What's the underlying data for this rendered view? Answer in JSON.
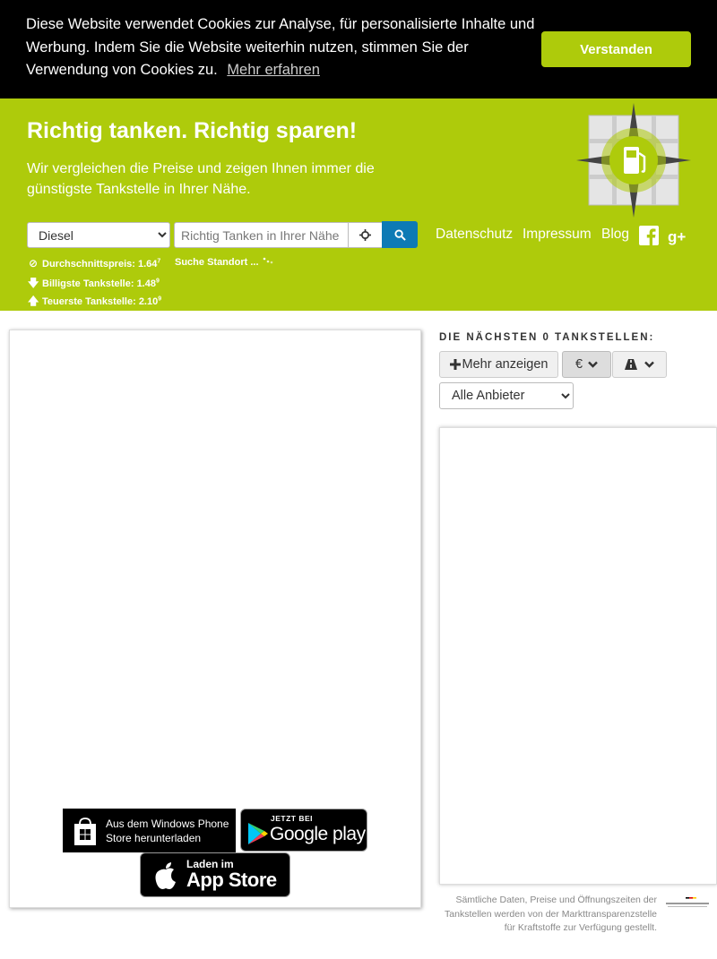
{
  "cookie": {
    "message": "Diese Website verwendet Cookies zur Analyse, für personalisierte Inhalte und Werbung. Indem Sie die Website weiterhin nutzen, stimmen Sie der Verwendung von Cookies zu.",
    "link": "Mehr erfahren",
    "button": "Verstanden"
  },
  "header": {
    "title": "Richtig tanken. Richtig sparen!",
    "subtitle": "Wir vergleichen die Preise und zeigen Ihnen immer die günstigste Tankstelle in Ihrer Nähe.",
    "fuel_selected": "Diesel",
    "search_placeholder": "Richtig Tanken in Ihrer Nähe",
    "nav": [
      "Datenschutz",
      "Impressum",
      "Blog"
    ],
    "locating": "Suche Standort ..."
  },
  "stats": {
    "avg_label": "Durchschnittspreis:",
    "avg_value": "1.64",
    "avg_sup": "7",
    "cheap_label": "Billigste Tankstelle:",
    "cheap_value": "1.48",
    "cheap_sup": "9",
    "exp_label": "Teuerste Tankstelle:",
    "exp_value": "2.10",
    "exp_sup": "9"
  },
  "badges": {
    "windows_line1": "Aus dem Windows Phone",
    "windows_line2": "Store herunterladen",
    "google_line1": "JETZT BEI",
    "google_line2": "Google play",
    "apple_line1": "Laden im",
    "apple_line2": "App Store"
  },
  "side": {
    "title": "DIE NÄCHSTEN 0 TANKSTELLEN:",
    "more_button": "Mehr anzeigen",
    "sort_symbol": "€",
    "provider_selected": "Alle Anbieter",
    "footer": "Sämtliche Daten, Preise und Öffnungszeiten der Tankstellen werden von der Markttransparenzstelle für Kraftstoffe zur Verfügung gestellt."
  },
  "colors": {
    "brand": "#aecb0b",
    "search_button": "#0d7ab5",
    "banner": "#000000"
  }
}
